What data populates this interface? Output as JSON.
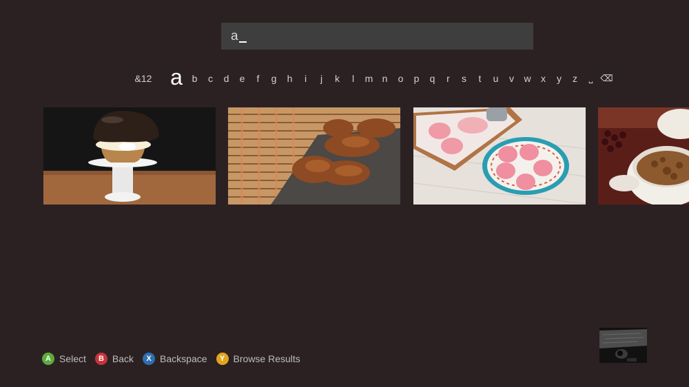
{
  "search": {
    "query": "a"
  },
  "keyboard": {
    "keys": [
      "&12",
      "a",
      "b",
      "c",
      "d",
      "e",
      "f",
      "g",
      "h",
      "i",
      "j",
      "k",
      "l",
      "m",
      "n",
      "o",
      "p",
      "q",
      "r",
      "s",
      "t",
      "u",
      "v",
      "w",
      "x",
      "y",
      "z",
      "˽",
      "⌫"
    ],
    "active_index": 1
  },
  "results": {
    "tiles": [
      {
        "icon": "cupcake-image"
      },
      {
        "icon": "fried-food-image"
      },
      {
        "icon": "pink-sweets-image"
      },
      {
        "icon": "stew-bowl-image"
      }
    ]
  },
  "hints": [
    {
      "button": "A",
      "label": "Select",
      "color": "#5cad3b"
    },
    {
      "button": "B",
      "label": "Back",
      "color": "#c8333a"
    },
    {
      "button": "X",
      "label": "Backspace",
      "color": "#2f6fb1"
    },
    {
      "button": "Y",
      "label": "Browse Results",
      "color": "#e0a51e"
    }
  ],
  "kinect": {
    "icon": "kinect-camera-preview"
  }
}
